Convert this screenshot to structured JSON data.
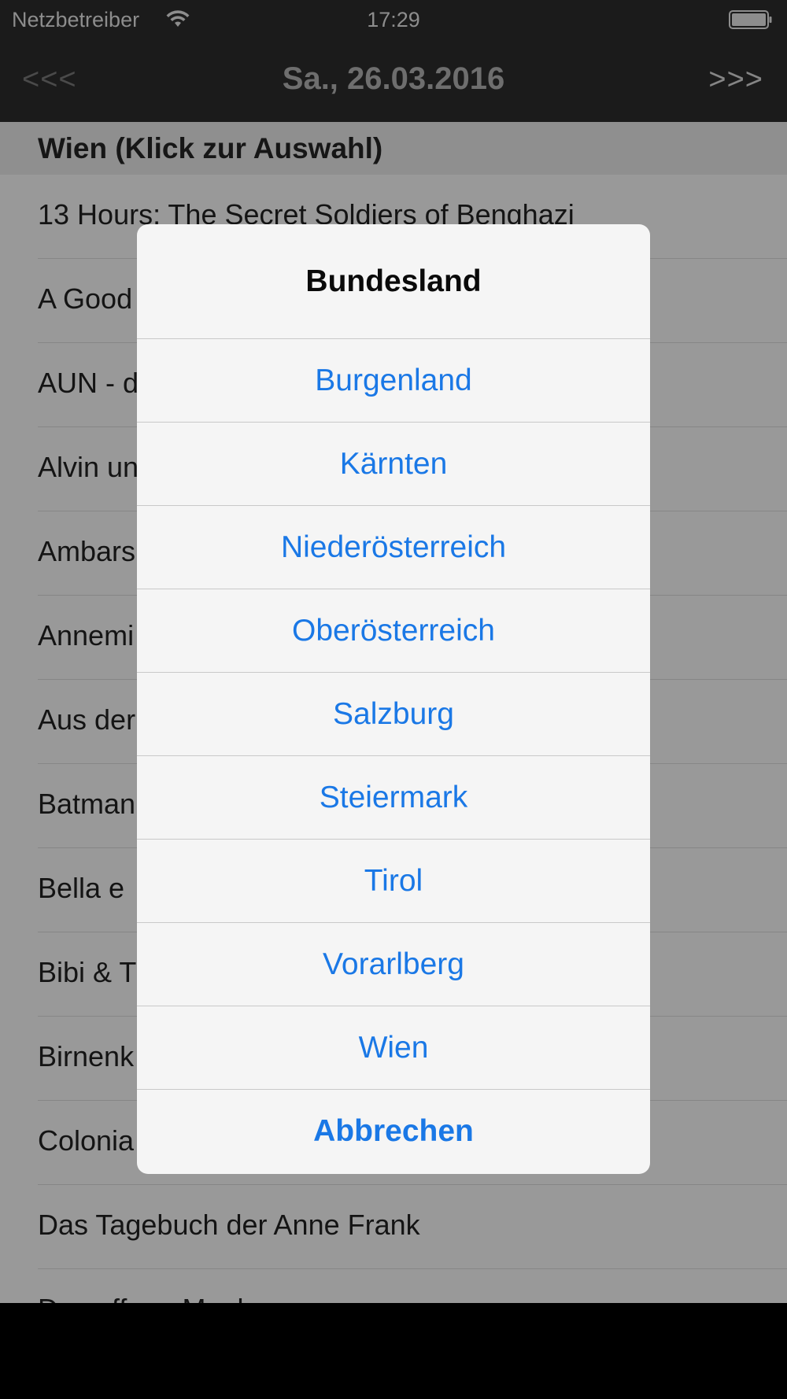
{
  "status_bar": {
    "carrier": "Netzbetreiber",
    "time": "17:29",
    "wifi_icon": "wifi-icon",
    "battery_icon": "battery-icon"
  },
  "nav": {
    "prev_label": "<<<",
    "title": "Sa., 26.03.2016",
    "next_label": ">>>"
  },
  "list": {
    "section_header": "Wien (Klick zur Auswahl)",
    "rows": [
      "13 Hours: The Secret Soldiers of Benghazi",
      "A Good",
      "AUN - d",
      "Alvin un",
      "Ambars",
      "Annemi",
      "Aus der",
      "Batman",
      "Bella e",
      "Bibi & T",
      "Birnenk",
      "Colonia",
      "Das Tagebuch der Anne Frank",
      "Das offene Maul"
    ]
  },
  "sheet": {
    "title": "Bundesland",
    "options": [
      "Burgenland",
      "Kärnten",
      "Niederösterreich",
      "Oberösterreich",
      "Salzburg",
      "Steiermark",
      "Tirol",
      "Vorarlberg",
      "Wien"
    ],
    "cancel_label": "Abbrechen"
  },
  "colors": {
    "accent": "#1a78e6",
    "bar_background": "#1b1b1b",
    "dimmed_content": "#999999"
  }
}
